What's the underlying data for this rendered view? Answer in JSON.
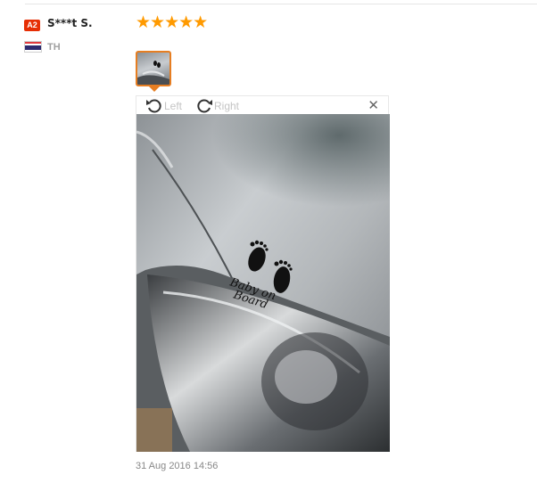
{
  "review": {
    "level_badge": "A2",
    "buyer_name": "S***t S.",
    "country_code": "TH",
    "rating_stars": "★★★★★",
    "rating_value": 5,
    "rating_max": 5,
    "date": "31 Aug 2016 14:56"
  },
  "viewer": {
    "rotate_left_label": "Left",
    "rotate_right_label": "Right",
    "close_glyph": "✕"
  },
  "photo": {
    "sticker_line1": "Baby on",
    "sticker_line2": "Board"
  },
  "colors": {
    "badge": "#e62e04",
    "stars": "#ff9a00",
    "thumb_border": "#e67e22",
    "car_paint": "#b9bdc0"
  },
  "icons": {
    "rotate_left": "rotate-left-icon",
    "rotate_right": "rotate-right-icon",
    "close": "close-icon",
    "flag": "thailand-flag-icon"
  }
}
